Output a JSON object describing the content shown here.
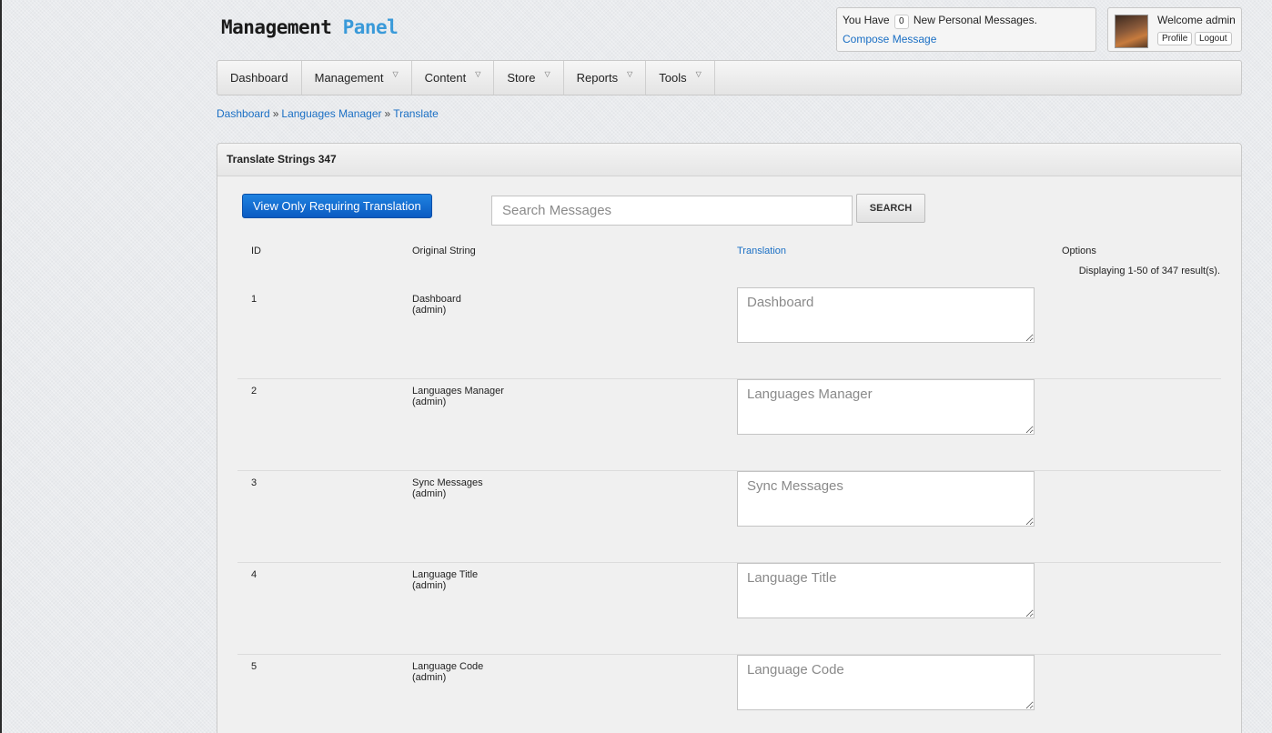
{
  "header": {
    "logo_bold": "Management",
    "logo_accent": "Panel",
    "messages": {
      "prefix": "You Have",
      "count": "0",
      "suffix": "New Personal Messages.",
      "compose": "Compose Message"
    },
    "user": {
      "welcome": "Welcome admin",
      "profile": "Profile",
      "logout": "Logout"
    }
  },
  "nav": [
    {
      "label": "Dashboard",
      "dropdown": false
    },
    {
      "label": "Management",
      "dropdown": true
    },
    {
      "label": "Content",
      "dropdown": true
    },
    {
      "label": "Store",
      "dropdown": true
    },
    {
      "label": "Reports",
      "dropdown": true
    },
    {
      "label": "Tools",
      "dropdown": true
    }
  ],
  "breadcrumb": [
    "Dashboard",
    "Languages Manager",
    "Translate"
  ],
  "breadcrumb_sep": "»",
  "panel": {
    "title": "Translate Strings 347",
    "filter_button": "View Only Requiring Translation",
    "search_placeholder": "Search Messages",
    "search_button": "SEARCH",
    "columns": {
      "id": "ID",
      "original": "Original String",
      "translation": "Translation",
      "options": "Options"
    },
    "displaying": "Displaying 1-50 of 347 result(s).",
    "rows": [
      {
        "id": "1",
        "original": "Dashboard",
        "context": "(admin)",
        "placeholder": "Dashboard"
      },
      {
        "id": "2",
        "original": "Languages Manager",
        "context": "(admin)",
        "placeholder": "Languages Manager"
      },
      {
        "id": "3",
        "original": "Sync Messages",
        "context": "(admin)",
        "placeholder": "Sync Messages"
      },
      {
        "id": "4",
        "original": "Language Title",
        "context": "(admin)",
        "placeholder": "Language Title"
      },
      {
        "id": "5",
        "original": "Language Code",
        "context": "(admin)",
        "placeholder": "Language Code"
      }
    ]
  },
  "colors": {
    "accent": "#3a9ad9",
    "link": "#1a6fc4",
    "primary_button": "#0b5bc2"
  }
}
